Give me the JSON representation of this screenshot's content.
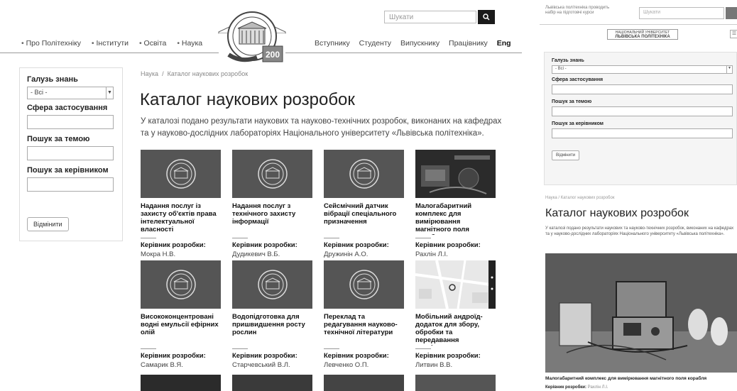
{
  "header": {
    "search_placeholder": "Шукати",
    "nav_left": [
      "Про Політехніку",
      "Інститути",
      "Освіта",
      "Наука"
    ],
    "nav_right": [
      "Вступнику",
      "Студенту",
      "Випускнику",
      "Працівнику"
    ],
    "lang": "Eng"
  },
  "filters": {
    "field_label": "Галузь знань",
    "field_value": "- Всі -",
    "scope_label": "Сфера застосування",
    "topic_label": "Пошук за темою",
    "supervisor_label": "Пошук за керівником",
    "reset_label": "Відмінити"
  },
  "breadcrumb": {
    "root": "Наука",
    "sep": "/",
    "current": "Каталог наукових розробок"
  },
  "page": {
    "title": "Каталог наукових розробок",
    "intro": "У каталозі подано результати наукових та науково-технічних розробок, виконаних на кафедрах та у науково-дослідних лабораторіях Національного університету «Львівська політехніка»."
  },
  "cards": [
    {
      "title": "Надання послуг із захисту об'єктів права інтелектуальної власності",
      "label": "Керівник розробки:",
      "person": "Мокра Н.В.",
      "thumb": "logo"
    },
    {
      "title": "Надання послуг з технічного захисту інформації",
      "label": "Керівник розробки:",
      "person": "Дудикевич В.Б.",
      "thumb": "logo"
    },
    {
      "title": "Сейсмічний датчик вібрації спеціального призначення",
      "label": "Керівник розробки:",
      "person": "Дружинін А.О.",
      "thumb": "logo"
    },
    {
      "title": "Малогабаритний комплекс для вимірювання магнітного поля корабля",
      "label": "Керівник розробки:",
      "person": "Рахлін Л.І.",
      "thumb": "photo"
    },
    {
      "title": "Висококонцентровані водні емульсії ефірних олій",
      "label": "Керівник розробки:",
      "person": "Самарик В.Я.",
      "thumb": "logo"
    },
    {
      "title": "Водопідготовка для пришвидшення росту рослин",
      "label": "Керівник розробки:",
      "person": "Старчевський В.Л.",
      "thumb": "logo"
    },
    {
      "title": "Переклад та редагування науково-технічної літератури",
      "label": "Керівник розробки:",
      "person": "Левченко О.П.",
      "thumb": "logo"
    },
    {
      "title": "Мобільний андроїд-додаток для збору, обробки та передавання розвідувальних даних",
      "label": "Керівник розробки:",
      "person": "Литвин В.В.",
      "thumb": "map"
    }
  ],
  "mobile": {
    "top_note": "Львівська політехніка проводить набір на підготовчі курси",
    "search_placeholder": "Шукати",
    "logo_text_1": "НАЦІОНАЛЬНИЙ УНІВЕРСИТЕТ",
    "logo_text_2": "ЛЬВІВСЬКА ПОЛІТЕХНІКА",
    "featured_title": "Малогабаритний комплекс для вимірювання магнітного поля корабля",
    "featured_label": "Керівник розробки:",
    "featured_person": "Рахлін Л.І."
  },
  "colors": {
    "accent_dark": "#1a1a1a",
    "thumb_gray": "#555555"
  }
}
